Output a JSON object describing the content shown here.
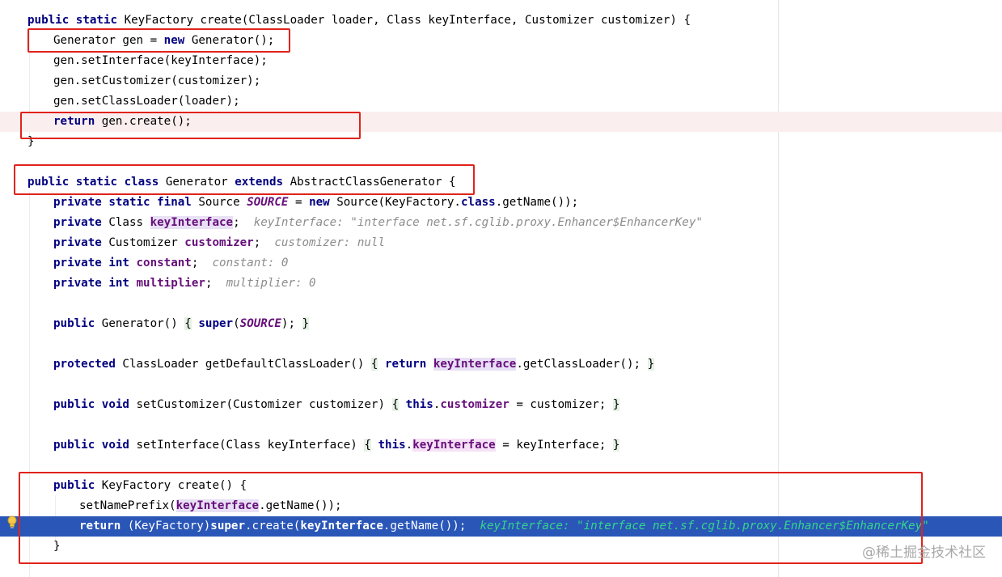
{
  "code_lines": [
    {
      "segments": [
        {
          "t": "public static",
          "c": "kw"
        },
        {
          "t": " KeyFactory create(ClassLoader loader, Class keyInterface, Customizer customizer) {"
        }
      ]
    },
    {
      "segments": [
        {
          "t": "Generator gen = "
        },
        {
          "t": "new",
          "c": "kw"
        },
        {
          "t": " Generator();"
        }
      ]
    },
    {
      "segments": [
        {
          "t": "gen.setInterface(keyInterface);"
        }
      ]
    },
    {
      "segments": [
        {
          "t": "gen.setCustomizer(customizer);"
        }
      ]
    },
    {
      "segments": [
        {
          "t": "gen.setClassLoader(loader);"
        }
      ]
    },
    {
      "segments": [
        {
          "t": "return",
          "c": "kw"
        },
        {
          "t": " gen.create();"
        }
      ]
    },
    {
      "segments": [
        {
          "t": "}"
        }
      ]
    },
    {
      "segments": []
    },
    {
      "segments": [
        {
          "t": "public static class",
          "c": "kw"
        },
        {
          "t": " Generator "
        },
        {
          "t": "extends",
          "c": "kw"
        },
        {
          "t": " AbstractClassGenerator {"
        }
      ]
    },
    {
      "segments": [
        {
          "t": "private static final",
          "c": "kw"
        },
        {
          "t": " Source "
        },
        {
          "t": "SOURCE",
          "c": "sfld"
        },
        {
          "t": " = "
        },
        {
          "t": "new",
          "c": "kw"
        },
        {
          "t": " Source(KeyFactory."
        },
        {
          "t": "class",
          "c": "kw"
        },
        {
          "t": ".getName());"
        }
      ]
    },
    {
      "segments": [
        {
          "t": "private",
          "c": "kw"
        },
        {
          "t": " Class "
        },
        {
          "t": "keyInterface",
          "c": "fld hl"
        },
        {
          "t": ";  "
        },
        {
          "t": "keyInterface: \"interface net.sf.cglib.proxy.Enhancer$EnhancerKey\"",
          "c": "hint"
        }
      ]
    },
    {
      "segments": [
        {
          "t": "private",
          "c": "kw"
        },
        {
          "t": " Customizer "
        },
        {
          "t": "customizer",
          "c": "fld"
        },
        {
          "t": ";  "
        },
        {
          "t": "customizer: null",
          "c": "hint"
        }
      ]
    },
    {
      "segments": [
        {
          "t": "private int",
          "c": "kw"
        },
        {
          "t": " "
        },
        {
          "t": "constant",
          "c": "fld"
        },
        {
          "t": ";  "
        },
        {
          "t": "constant: 0",
          "c": "hint"
        }
      ]
    },
    {
      "segments": [
        {
          "t": "private int",
          "c": "kw"
        },
        {
          "t": " "
        },
        {
          "t": "multiplier",
          "c": "fld"
        },
        {
          "t": ";  "
        },
        {
          "t": "multiplier: 0",
          "c": "hint"
        }
      ]
    },
    {
      "segments": []
    },
    {
      "segments": [
        {
          "t": "public",
          "c": "kw"
        },
        {
          "t": " Generator() "
        },
        {
          "t": "{",
          "c": "fold"
        },
        {
          "t": " "
        },
        {
          "t": "super",
          "c": "kw"
        },
        {
          "t": "("
        },
        {
          "t": "SOURCE",
          "c": "sfld"
        },
        {
          "t": "); "
        },
        {
          "t": "}",
          "c": "fold"
        }
      ]
    },
    {
      "segments": []
    },
    {
      "segments": [
        {
          "t": "protected",
          "c": "kw"
        },
        {
          "t": " ClassLoader getDefaultClassLoader() "
        },
        {
          "t": "{",
          "c": "fold"
        },
        {
          "t": " "
        },
        {
          "t": "return",
          "c": "kw"
        },
        {
          "t": " "
        },
        {
          "t": "keyInterface",
          "c": "fld hl"
        },
        {
          "t": ".getClassLoader(); "
        },
        {
          "t": "}",
          "c": "fold"
        }
      ]
    },
    {
      "segments": []
    },
    {
      "segments": [
        {
          "t": "public void",
          "c": "kw"
        },
        {
          "t": " setCustomizer(Customizer customizer) "
        },
        {
          "t": "{",
          "c": "fold"
        },
        {
          "t": " "
        },
        {
          "t": "this",
          "c": "kw"
        },
        {
          "t": "."
        },
        {
          "t": "customizer",
          "c": "fld"
        },
        {
          "t": " = customizer; "
        },
        {
          "t": "}",
          "c": "fold"
        }
      ]
    },
    {
      "segments": []
    },
    {
      "segments": [
        {
          "t": "public void",
          "c": "kw"
        },
        {
          "t": " setInterface(Class keyInterface) "
        },
        {
          "t": "{",
          "c": "fold"
        },
        {
          "t": " "
        },
        {
          "t": "this",
          "c": "kw"
        },
        {
          "t": "."
        },
        {
          "t": "keyInterface",
          "c": "fld hl2"
        },
        {
          "t": " = keyInterface; "
        },
        {
          "t": "}",
          "c": "fold"
        }
      ]
    },
    {
      "segments": []
    },
    {
      "segments": [
        {
          "t": "public",
          "c": "kw"
        },
        {
          "t": " KeyFactory create() {"
        }
      ]
    },
    {
      "segments": [
        {
          "t": "setNamePrefix("
        },
        {
          "t": "keyInterface",
          "c": "fld hl"
        },
        {
          "t": ".getName());"
        }
      ]
    },
    {
      "segments": [
        {
          "t": "return",
          "c": "kw"
        },
        {
          "t": " (KeyFactory)"
        },
        {
          "t": "super",
          "c": "kw"
        },
        {
          "t": ".create("
        },
        {
          "t": "keyInterface",
          "c": "fld"
        },
        {
          "t": ".getName());  "
        },
        {
          "t": "keyInterface: \"interface net.sf.cglib.proxy.Enhancer$EnhancerKey\"",
          "c": "hint"
        }
      ]
    },
    {
      "segments": [
        {
          "t": "}"
        }
      ]
    }
  ],
  "breakpoint_icon": "lightbulb-icon",
  "annotation_color": "#e0231b",
  "current_line_color": "#2a56b8",
  "watermark": "@稀土掘金技术社区"
}
